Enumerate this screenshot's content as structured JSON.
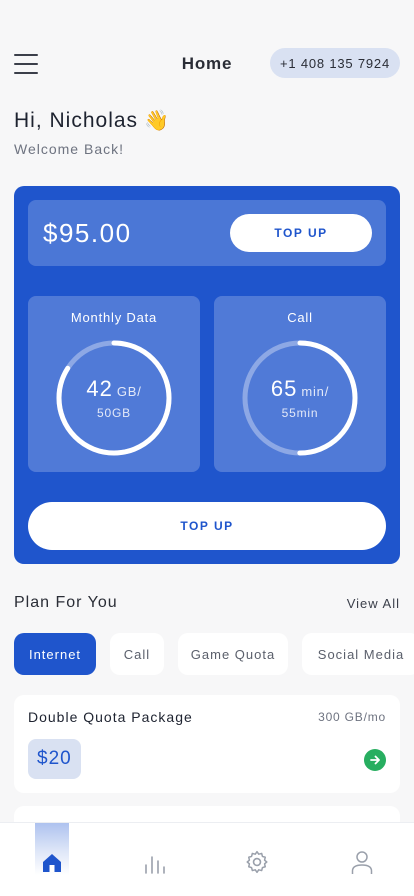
{
  "header": {
    "title": "Home",
    "phone": "+1 408 135 7924"
  },
  "greeting": {
    "text": "Hi, Nicholas",
    "emoji": "👋",
    "subtitle": "Welcome Back!"
  },
  "balance": {
    "amount": "$95.00",
    "topup_label": "TOP UP"
  },
  "stats": {
    "data": {
      "title": "Monthly Data",
      "value": "42",
      "unit": "GB/",
      "total": "50GB",
      "fraction": 0.84
    },
    "call": {
      "title": "Call",
      "value": "65",
      "unit": "min/",
      "total": "55min",
      "fraction": 0.5
    }
  },
  "topup_button_label": "TOP UP",
  "plans_section": {
    "title": "Plan For You",
    "view_all": "View All",
    "chips": [
      "Internet",
      "Call",
      "Game Quota",
      "Social Media"
    ],
    "active_chip": "Internet"
  },
  "plan_card": {
    "name": "Double Quota Package",
    "quota": "300 GB/mo",
    "price": "$20"
  },
  "nav": {
    "items": [
      "home-icon",
      "stats-icon",
      "settings-icon",
      "profile-icon"
    ],
    "active": "home-icon"
  },
  "colors": {
    "primary": "#1f55cc",
    "accent_green": "#27ae60",
    "chip_bg": "#d9e1f2"
  }
}
